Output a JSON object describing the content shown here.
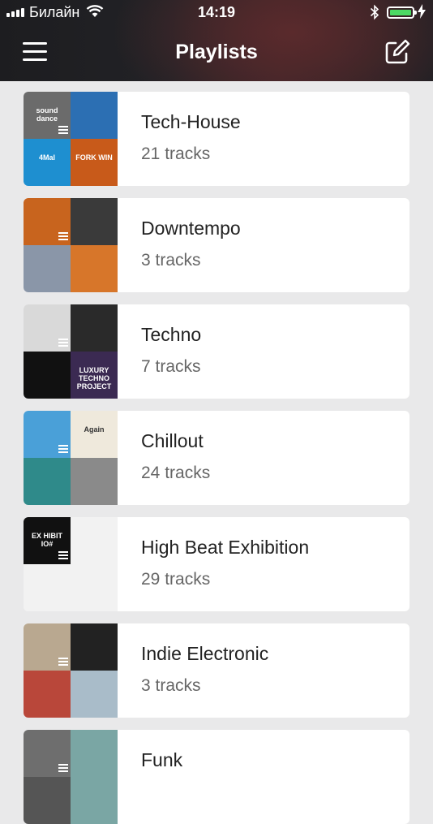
{
  "status_bar": {
    "carrier": "Билайн",
    "time": "14:19",
    "battery_level": 1.0,
    "charging": true
  },
  "nav": {
    "title": "Playlists",
    "menu_icon": "hamburger-menu-icon",
    "edit_icon": "compose-edit-icon"
  },
  "playlists": [
    {
      "name": "Tech-House",
      "count": "21 tracks",
      "covers": [
        "#6b6b6b",
        "#2c6fb3",
        "#1e8fd0",
        "#c85a1a"
      ],
      "cover_text": [
        "sound dance",
        "",
        "4Mal",
        "FORK WIN"
      ]
    },
    {
      "name": "Downtempo",
      "count": "3 tracks",
      "covers": [
        "#c8641e",
        "#3a3a3a",
        "#8a96a8",
        "#d7762a"
      ],
      "cover_text": [
        "",
        "",
        "",
        ""
      ]
    },
    {
      "name": "Techno",
      "count": "7 tracks",
      "covers": [
        "#d9d9d9",
        "#2a2a2a",
        "#111111",
        "#3b2a52"
      ],
      "cover_text": [
        "",
        "",
        "",
        "LUXURY TECHNO PROJECT #000"
      ]
    },
    {
      "name": "Chillout",
      "count": "24 tracks",
      "covers": [
        "#4aa0d8",
        "#efe9dc",
        "#2f8a8a",
        "#8a8a8a"
      ],
      "cover_text": [
        "",
        "Again",
        "",
        ""
      ]
    },
    {
      "name": "High Beat Exhibition",
      "count": "29 tracks",
      "covers": [
        "#111111",
        "#f2f2f2",
        "#f2f2f2",
        "#f2f2f2"
      ],
      "cover_text": [
        "EX HIBIT IO#",
        "",
        "",
        ""
      ]
    },
    {
      "name": "Indie Electronic",
      "count": "3 tracks",
      "covers": [
        "#b9a890",
        "#222222",
        "#b9473a",
        "#a9bcc9"
      ],
      "cover_text": [
        "",
        "",
        "",
        ""
      ]
    },
    {
      "name": "Funk",
      "count": "",
      "covers": [
        "#6e6e6e",
        "#7aa6a4",
        "#555555",
        "#7aa6a4"
      ],
      "cover_text": [
        "",
        "",
        "",
        ""
      ]
    }
  ]
}
